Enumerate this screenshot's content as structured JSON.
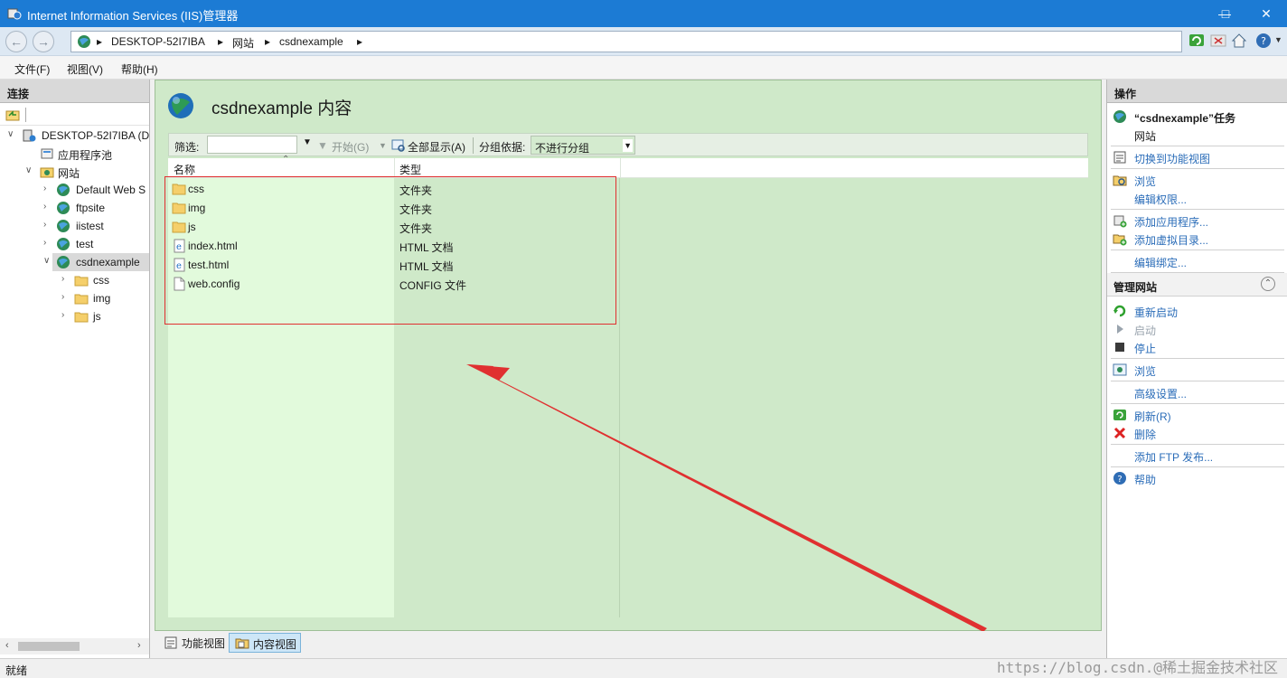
{
  "window": {
    "title": "Internet Information Services (IIS)管理器"
  },
  "address": {
    "crumbs": [
      "DESKTOP-52I7IBA",
      "网站",
      "csdnexample"
    ]
  },
  "menu": {
    "file": "文件(F)",
    "view": "视图(V)",
    "help": "帮助(H)"
  },
  "connections": {
    "header": "连接",
    "tree": [
      {
        "label": "DESKTOP-52I7IBA (D",
        "icon": "server-icon"
      },
      {
        "label": "应用程序池",
        "icon": "app-pool-icon"
      },
      {
        "label": "网站",
        "icon": "sites-folder-icon"
      },
      {
        "label": "Default Web S",
        "icon": "globe-icon"
      },
      {
        "label": "ftpsite",
        "icon": "globe-icon"
      },
      {
        "label": "iistest",
        "icon": "globe-icon"
      },
      {
        "label": "test",
        "icon": "globe-icon"
      },
      {
        "label": "csdnexample",
        "icon": "globe-icon"
      },
      {
        "label": "css",
        "icon": "folder-icon"
      },
      {
        "label": "img",
        "icon": "folder-icon"
      },
      {
        "label": "js",
        "icon": "folder-icon"
      }
    ]
  },
  "content": {
    "title": "csdnexample 内容",
    "filter_label": "筛选:",
    "start_label": "开始(G)",
    "show_all_label": "全部显示(A)",
    "group_by_label": "分组依据:",
    "group_by_value": "不进行分组",
    "col_name": "名称",
    "col_type": "类型",
    "files": [
      {
        "name": "css",
        "type": "文件夹",
        "icon": "folder-icon"
      },
      {
        "name": "img",
        "type": "文件夹",
        "icon": "folder-icon"
      },
      {
        "name": "js",
        "type": "文件夹",
        "icon": "folder-icon"
      },
      {
        "name": "index.html",
        "type": "HTML 文档",
        "icon": "html-file-icon"
      },
      {
        "name": "test.html",
        "type": "HTML 文档",
        "icon": "html-file-icon"
      },
      {
        "name": "web.config",
        "type": "CONFIG 文件",
        "icon": "config-file-icon"
      }
    ]
  },
  "view_tabs": {
    "features": "功能视图",
    "content": "内容视图"
  },
  "actions": {
    "header": "操作",
    "task_title": "“csdnexample”任务",
    "task_sub": "网站",
    "switch_features": "切换到功能视图",
    "explore": "浏览",
    "edit_permissions": "编辑权限...",
    "add_application": "添加应用程序...",
    "add_virtual_dir": "添加虚拟目录...",
    "edit_bindings": "编辑绑定...",
    "manage_site": "管理网站",
    "restart": "重新启动",
    "start": "启动",
    "stop": "停止",
    "browse": "浏览",
    "advanced": "高级设置...",
    "refresh": "刷新(R)",
    "delete": "删除",
    "add_ftp": "添加 FTP 发布...",
    "help": "帮助"
  },
  "status": {
    "text": "就绪",
    "watermark": "https://blog.csdn.@稀土掘金技术社区"
  },
  "colors": {
    "accent": "#1c7bd4",
    "content_bg": "#cfe9c9",
    "annotation_red": "#e03030"
  }
}
